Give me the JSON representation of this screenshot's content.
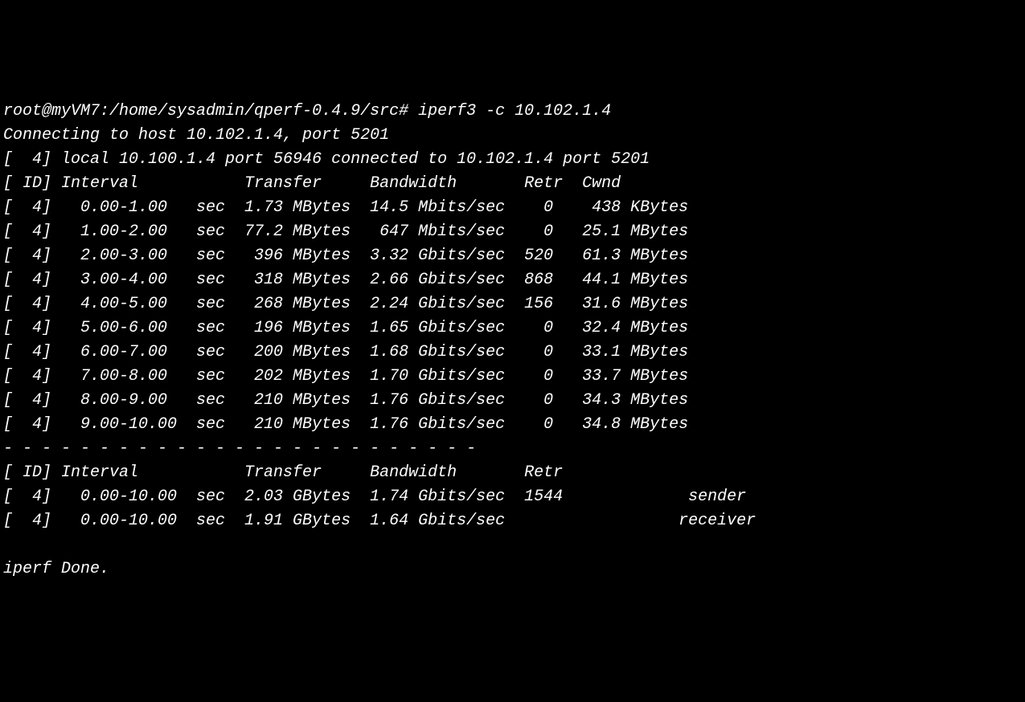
{
  "prompt": "root@myVM7:/home/sysadmin/qperf-0.4.9/src#",
  "command": "iperf3 -c 10.102.1.4",
  "connecting_line": "Connecting to host 10.102.1.4, port 5201",
  "local_line": "[  4] local 10.100.1.4 port 56946 connected to 10.102.1.4 port 5201",
  "header1": "[ ID] Interval           Transfer     Bandwidth       Retr  Cwnd",
  "rows": [
    "[  4]   0.00-1.00   sec  1.73 MBytes  14.5 Mbits/sec    0    438 KBytes",
    "[  4]   1.00-2.00   sec  77.2 MBytes   647 Mbits/sec    0   25.1 MBytes",
    "[  4]   2.00-3.00   sec   396 MBytes  3.32 Gbits/sec  520   61.3 MBytes",
    "[  4]   3.00-4.00   sec   318 MBytes  2.66 Gbits/sec  868   44.1 MBytes",
    "[  4]   4.00-5.00   sec   268 MBytes  2.24 Gbits/sec  156   31.6 MBytes",
    "[  4]   5.00-6.00   sec   196 MBytes  1.65 Gbits/sec    0   32.4 MBytes",
    "[  4]   6.00-7.00   sec   200 MBytes  1.68 Gbits/sec    0   33.1 MBytes",
    "[  4]   7.00-8.00   sec   202 MBytes  1.70 Gbits/sec    0   33.7 MBytes",
    "[  4]   8.00-9.00   sec   210 MBytes  1.76 Gbits/sec    0   34.3 MBytes",
    "[  4]   9.00-10.00  sec   210 MBytes  1.76 Gbits/sec    0   34.8 MBytes"
  ],
  "separator": "- - - - - - - - - - - - - - - - - - - - - - - - -",
  "header2": "[ ID] Interval           Transfer     Bandwidth       Retr",
  "summary": [
    "[  4]   0.00-10.00  sec  2.03 GBytes  1.74 Gbits/sec  1544             sender",
    "[  4]   0.00-10.00  sec  1.91 GBytes  1.64 Gbits/sec                  receiver"
  ],
  "done_line": "iperf Done.",
  "chart_data": {
    "type": "table",
    "title": "iperf3 bandwidth test output",
    "columns": [
      "ID",
      "Interval",
      "Transfer",
      "Bandwidth",
      "Retr",
      "Cwnd"
    ],
    "data_rows": [
      {
        "id": 4,
        "interval": "0.00-1.00 sec",
        "transfer": "1.73 MBytes",
        "bandwidth": "14.5 Mbits/sec",
        "retr": 0,
        "cwnd": "438 KBytes"
      },
      {
        "id": 4,
        "interval": "1.00-2.00 sec",
        "transfer": "77.2 MBytes",
        "bandwidth": "647 Mbits/sec",
        "retr": 0,
        "cwnd": "25.1 MBytes"
      },
      {
        "id": 4,
        "interval": "2.00-3.00 sec",
        "transfer": "396 MBytes",
        "bandwidth": "3.32 Gbits/sec",
        "retr": 520,
        "cwnd": "61.3 MBytes"
      },
      {
        "id": 4,
        "interval": "3.00-4.00 sec",
        "transfer": "318 MBytes",
        "bandwidth": "2.66 Gbits/sec",
        "retr": 868,
        "cwnd": "44.1 MBytes"
      },
      {
        "id": 4,
        "interval": "4.00-5.00 sec",
        "transfer": "268 MBytes",
        "bandwidth": "2.24 Gbits/sec",
        "retr": 156,
        "cwnd": "31.6 MBytes"
      },
      {
        "id": 4,
        "interval": "5.00-6.00 sec",
        "transfer": "196 MBytes",
        "bandwidth": "1.65 Gbits/sec",
        "retr": 0,
        "cwnd": "32.4 MBytes"
      },
      {
        "id": 4,
        "interval": "6.00-7.00 sec",
        "transfer": "200 MBytes",
        "bandwidth": "1.68 Gbits/sec",
        "retr": 0,
        "cwnd": "33.1 MBytes"
      },
      {
        "id": 4,
        "interval": "7.00-8.00 sec",
        "transfer": "202 MBytes",
        "bandwidth": "1.70 Gbits/sec",
        "retr": 0,
        "cwnd": "33.7 MBytes"
      },
      {
        "id": 4,
        "interval": "8.00-9.00 sec",
        "transfer": "210 MBytes",
        "bandwidth": "1.76 Gbits/sec",
        "retr": 0,
        "cwnd": "34.3 MBytes"
      },
      {
        "id": 4,
        "interval": "9.00-10.00 sec",
        "transfer": "210 MBytes",
        "bandwidth": "1.76 Gbits/sec",
        "retr": 0,
        "cwnd": "34.8 MBytes"
      }
    ],
    "summary_rows": [
      {
        "id": 4,
        "interval": "0.00-10.00 sec",
        "transfer": "2.03 GBytes",
        "bandwidth": "1.74 Gbits/sec",
        "retr": 1544,
        "role": "sender"
      },
      {
        "id": 4,
        "interval": "0.00-10.00 sec",
        "transfer": "1.91 GBytes",
        "bandwidth": "1.64 Gbits/sec",
        "retr": null,
        "role": "receiver"
      }
    ]
  }
}
